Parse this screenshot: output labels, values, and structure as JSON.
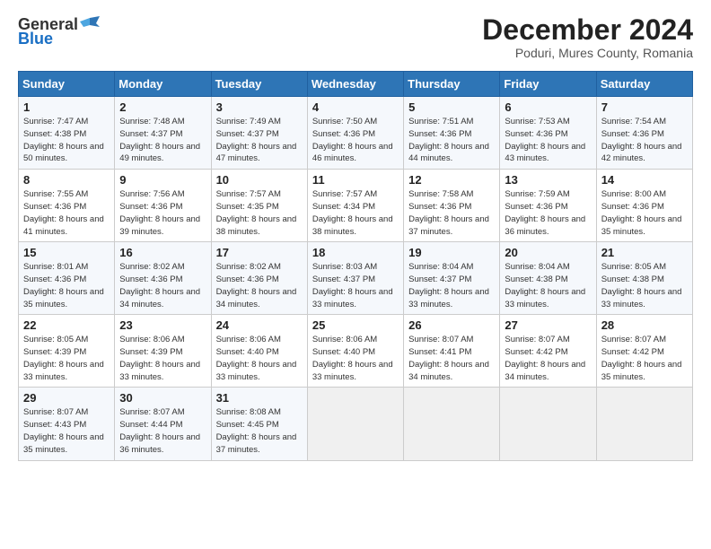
{
  "header": {
    "logo_general": "General",
    "logo_blue": "Blue",
    "month_title": "December 2024",
    "location": "Poduri, Mures County, Romania"
  },
  "weekdays": [
    "Sunday",
    "Monday",
    "Tuesday",
    "Wednesday",
    "Thursday",
    "Friday",
    "Saturday"
  ],
  "weeks": [
    [
      {
        "day": "1",
        "sunrise": "Sunrise: 7:47 AM",
        "sunset": "Sunset: 4:38 PM",
        "daylight": "Daylight: 8 hours and 50 minutes."
      },
      {
        "day": "2",
        "sunrise": "Sunrise: 7:48 AM",
        "sunset": "Sunset: 4:37 PM",
        "daylight": "Daylight: 8 hours and 49 minutes."
      },
      {
        "day": "3",
        "sunrise": "Sunrise: 7:49 AM",
        "sunset": "Sunset: 4:37 PM",
        "daylight": "Daylight: 8 hours and 47 minutes."
      },
      {
        "day": "4",
        "sunrise": "Sunrise: 7:50 AM",
        "sunset": "Sunset: 4:36 PM",
        "daylight": "Daylight: 8 hours and 46 minutes."
      },
      {
        "day": "5",
        "sunrise": "Sunrise: 7:51 AM",
        "sunset": "Sunset: 4:36 PM",
        "daylight": "Daylight: 8 hours and 44 minutes."
      },
      {
        "day": "6",
        "sunrise": "Sunrise: 7:53 AM",
        "sunset": "Sunset: 4:36 PM",
        "daylight": "Daylight: 8 hours and 43 minutes."
      },
      {
        "day": "7",
        "sunrise": "Sunrise: 7:54 AM",
        "sunset": "Sunset: 4:36 PM",
        "daylight": "Daylight: 8 hours and 42 minutes."
      }
    ],
    [
      {
        "day": "8",
        "sunrise": "Sunrise: 7:55 AM",
        "sunset": "Sunset: 4:36 PM",
        "daylight": "Daylight: 8 hours and 41 minutes."
      },
      {
        "day": "9",
        "sunrise": "Sunrise: 7:56 AM",
        "sunset": "Sunset: 4:36 PM",
        "daylight": "Daylight: 8 hours and 39 minutes."
      },
      {
        "day": "10",
        "sunrise": "Sunrise: 7:57 AM",
        "sunset": "Sunset: 4:35 PM",
        "daylight": "Daylight: 8 hours and 38 minutes."
      },
      {
        "day": "11",
        "sunrise": "Sunrise: 7:57 AM",
        "sunset": "Sunset: 4:34 PM",
        "daylight": "Daylight: 8 hours and 38 minutes."
      },
      {
        "day": "12",
        "sunrise": "Sunrise: 7:58 AM",
        "sunset": "Sunset: 4:36 PM",
        "daylight": "Daylight: 8 hours and 37 minutes."
      },
      {
        "day": "13",
        "sunrise": "Sunrise: 7:59 AM",
        "sunset": "Sunset: 4:36 PM",
        "daylight": "Daylight: 8 hours and 36 minutes."
      },
      {
        "day": "14",
        "sunrise": "Sunrise: 8:00 AM",
        "sunset": "Sunset: 4:36 PM",
        "daylight": "Daylight: 8 hours and 35 minutes."
      }
    ],
    [
      {
        "day": "15",
        "sunrise": "Sunrise: 8:01 AM",
        "sunset": "Sunset: 4:36 PM",
        "daylight": "Daylight: 8 hours and 35 minutes."
      },
      {
        "day": "16",
        "sunrise": "Sunrise: 8:02 AM",
        "sunset": "Sunset: 4:36 PM",
        "daylight": "Daylight: 8 hours and 34 minutes."
      },
      {
        "day": "17",
        "sunrise": "Sunrise: 8:02 AM",
        "sunset": "Sunset: 4:36 PM",
        "daylight": "Daylight: 8 hours and 34 minutes."
      },
      {
        "day": "18",
        "sunrise": "Sunrise: 8:03 AM",
        "sunset": "Sunset: 4:37 PM",
        "daylight": "Daylight: 8 hours and 33 minutes."
      },
      {
        "day": "19",
        "sunrise": "Sunrise: 8:04 AM",
        "sunset": "Sunset: 4:37 PM",
        "daylight": "Daylight: 8 hours and 33 minutes."
      },
      {
        "day": "20",
        "sunrise": "Sunrise: 8:04 AM",
        "sunset": "Sunset: 4:38 PM",
        "daylight": "Daylight: 8 hours and 33 minutes."
      },
      {
        "day": "21",
        "sunrise": "Sunrise: 8:05 AM",
        "sunset": "Sunset: 4:38 PM",
        "daylight": "Daylight: 8 hours and 33 minutes."
      }
    ],
    [
      {
        "day": "22",
        "sunrise": "Sunrise: 8:05 AM",
        "sunset": "Sunset: 4:39 PM",
        "daylight": "Daylight: 8 hours and 33 minutes."
      },
      {
        "day": "23",
        "sunrise": "Sunrise: 8:06 AM",
        "sunset": "Sunset: 4:39 PM",
        "daylight": "Daylight: 8 hours and 33 minutes."
      },
      {
        "day": "24",
        "sunrise": "Sunrise: 8:06 AM",
        "sunset": "Sunset: 4:40 PM",
        "daylight": "Daylight: 8 hours and 33 minutes."
      },
      {
        "day": "25",
        "sunrise": "Sunrise: 8:06 AM",
        "sunset": "Sunset: 4:40 PM",
        "daylight": "Daylight: 8 hours and 33 minutes."
      },
      {
        "day": "26",
        "sunrise": "Sunrise: 8:07 AM",
        "sunset": "Sunset: 4:41 PM",
        "daylight": "Daylight: 8 hours and 34 minutes."
      },
      {
        "day": "27",
        "sunrise": "Sunrise: 8:07 AM",
        "sunset": "Sunset: 4:42 PM",
        "daylight": "Daylight: 8 hours and 34 minutes."
      },
      {
        "day": "28",
        "sunrise": "Sunrise: 8:07 AM",
        "sunset": "Sunset: 4:42 PM",
        "daylight": "Daylight: 8 hours and 35 minutes."
      }
    ],
    [
      {
        "day": "29",
        "sunrise": "Sunrise: 8:07 AM",
        "sunset": "Sunset: 4:43 PM",
        "daylight": "Daylight: 8 hours and 35 minutes."
      },
      {
        "day": "30",
        "sunrise": "Sunrise: 8:07 AM",
        "sunset": "Sunset: 4:44 PM",
        "daylight": "Daylight: 8 hours and 36 minutes."
      },
      {
        "day": "31",
        "sunrise": "Sunrise: 8:08 AM",
        "sunset": "Sunset: 4:45 PM",
        "daylight": "Daylight: 8 hours and 37 minutes."
      },
      null,
      null,
      null,
      null
    ]
  ]
}
